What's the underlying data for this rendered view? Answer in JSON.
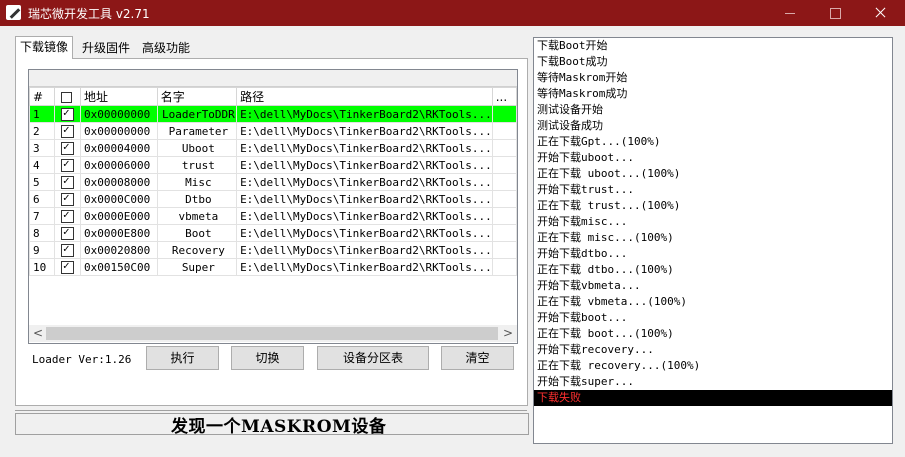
{
  "window": {
    "title": "瑞芯微开发工具 v2.71"
  },
  "tabs": [
    {
      "label": "下载镜像",
      "active": true
    },
    {
      "label": "升级固件",
      "active": false
    },
    {
      "label": "高级功能",
      "active": false
    }
  ],
  "table": {
    "headers": {
      "num": "#",
      "address": "地址",
      "name": "名字",
      "path": "路径",
      "more": "..."
    },
    "rows": [
      {
        "num": "1",
        "address": "0x00000000",
        "name": "LoaderToDDR",
        "path": "E:\\dell\\MyDocs\\TinkerBoard2\\RKTools...",
        "selected": true
      },
      {
        "num": "2",
        "address": "0x00000000",
        "name": "Parameter",
        "path": "E:\\dell\\MyDocs\\TinkerBoard2\\RKTools..."
      },
      {
        "num": "3",
        "address": "0x00004000",
        "name": "Uboot",
        "path": "E:\\dell\\MyDocs\\TinkerBoard2\\RKTools..."
      },
      {
        "num": "4",
        "address": "0x00006000",
        "name": "trust",
        "path": "E:\\dell\\MyDocs\\TinkerBoard2\\RKTools..."
      },
      {
        "num": "5",
        "address": "0x00008000",
        "name": "Misc",
        "path": "E:\\dell\\MyDocs\\TinkerBoard2\\RKTools..."
      },
      {
        "num": "6",
        "address": "0x0000C000",
        "name": "Dtbo",
        "path": "E:\\dell\\MyDocs\\TinkerBoard2\\RKTools..."
      },
      {
        "num": "7",
        "address": "0x0000E000",
        "name": "vbmeta",
        "path": "E:\\dell\\MyDocs\\TinkerBoard2\\RKTools..."
      },
      {
        "num": "8",
        "address": "0x0000E800",
        "name": "Boot",
        "path": "E:\\dell\\MyDocs\\TinkerBoard2\\RKTools..."
      },
      {
        "num": "9",
        "address": "0x00020800",
        "name": "Recovery",
        "path": "E:\\dell\\MyDocs\\TinkerBoard2\\RKTools..."
      },
      {
        "num": "10",
        "address": "0x00150C00",
        "name": "Super",
        "path": "E:\\dell\\MyDocs\\TinkerBoard2\\RKTools..."
      }
    ]
  },
  "loader_version": "Loader Ver:1.26",
  "buttons": {
    "execute": "执行",
    "switch": "切换",
    "partition_table": "设备分区表",
    "clear": "清空"
  },
  "status_text": "发现一个MASKROM设备",
  "log": [
    "下载Boot开始",
    "下载Boot成功",
    "等待Maskrom开始",
    "等待Maskrom成功",
    "测试设备开始",
    "测试设备成功",
    "正在下载Gpt...(100%)",
    "开始下载uboot...",
    "正在下载 uboot...(100%)",
    "开始下载trust...",
    "正在下载 trust...(100%)",
    "开始下载misc...",
    "正在下载 misc...(100%)",
    "开始下载dtbo...",
    "正在下载 dtbo...(100%)",
    "开始下载vbmeta...",
    "正在下载 vbmeta...(100%)",
    "开始下载boot...",
    "正在下载 boot...(100%)",
    "开始下载recovery...",
    "正在下载 recovery...(100%)",
    "开始下载super..."
  ],
  "log_error": "下载失败",
  "colors": {
    "titlebar": "#8c1717",
    "selected_row": "#00ff00",
    "error_text": "#ff3030",
    "error_bg": "#000000"
  }
}
